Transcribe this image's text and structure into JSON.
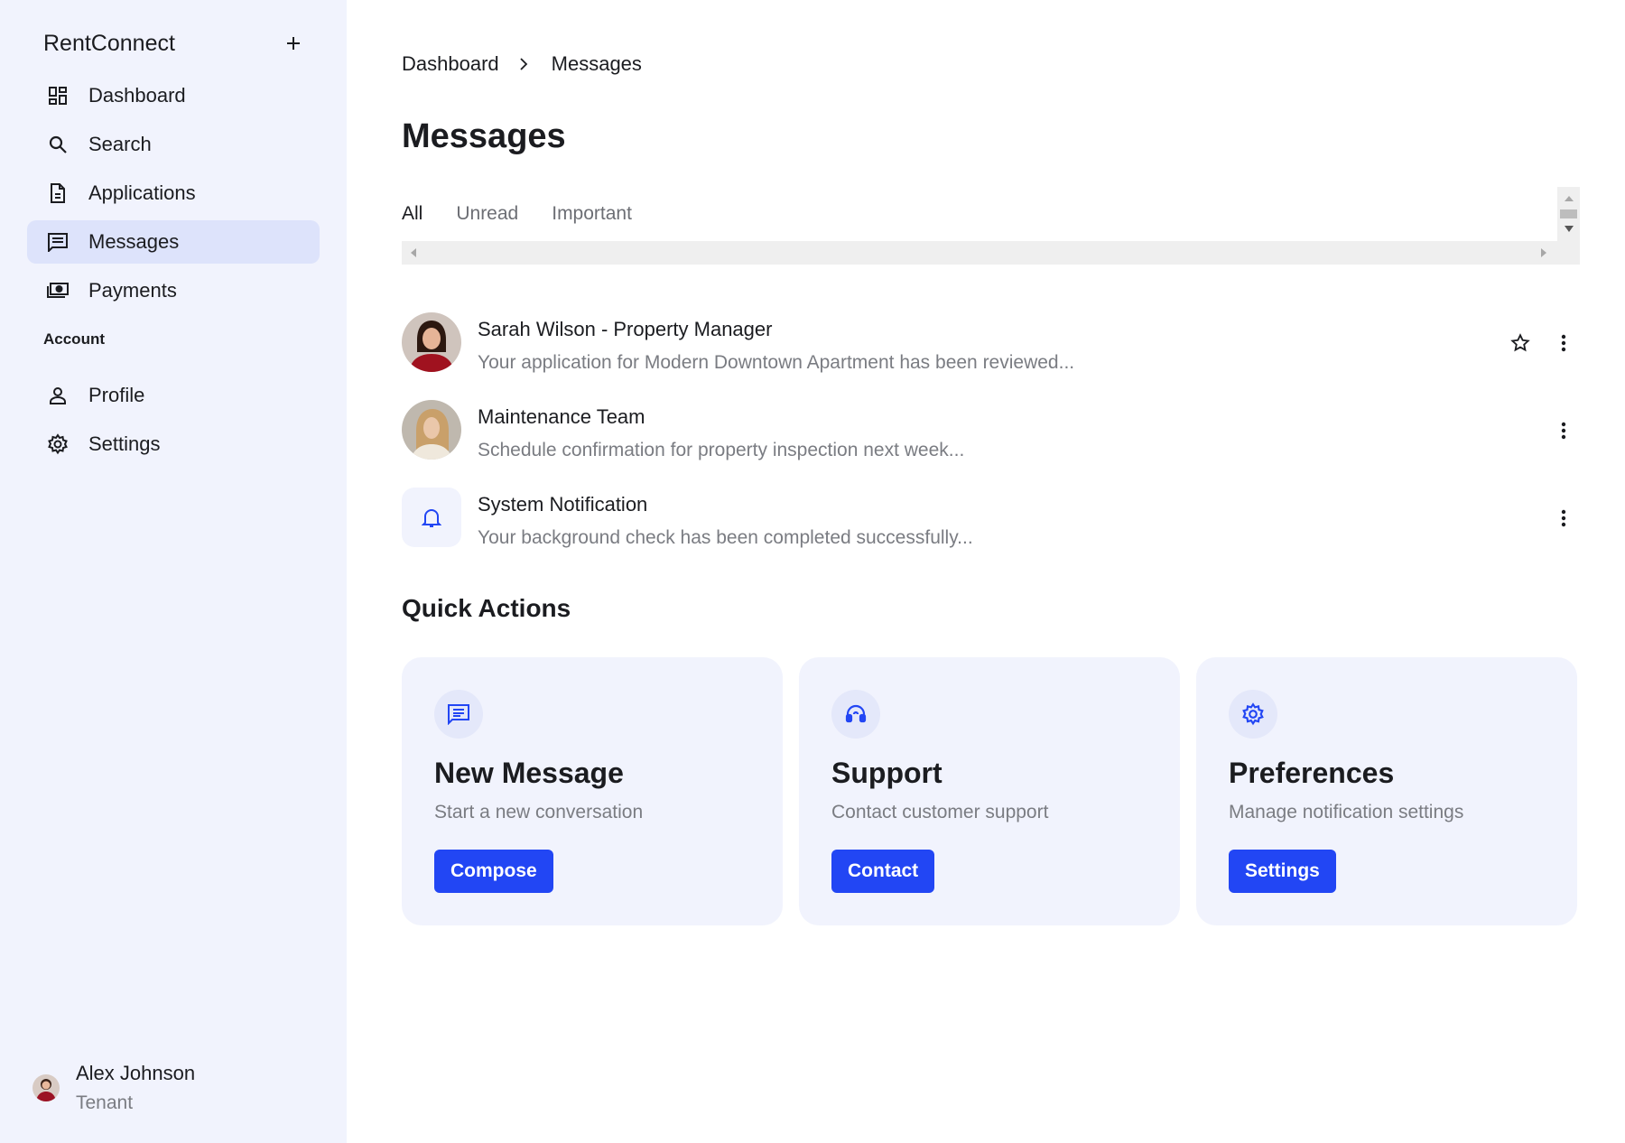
{
  "app": {
    "name": "RentConnect"
  },
  "sidebar": {
    "items": [
      {
        "label": "Dashboard",
        "icon": "dashboard-icon"
      },
      {
        "label": "Search",
        "icon": "search-icon"
      },
      {
        "label": "Applications",
        "icon": "document-icon"
      },
      {
        "label": "Messages",
        "icon": "message-icon",
        "active": true
      },
      {
        "label": "Payments",
        "icon": "payments-icon"
      }
    ],
    "section_label": "Account",
    "account_items": [
      {
        "label": "Profile",
        "icon": "person-icon"
      },
      {
        "label": "Settings",
        "icon": "gear-icon"
      }
    ]
  },
  "user": {
    "name": "Alex Johnson",
    "role": "Tenant"
  },
  "breadcrumb": {
    "items": [
      "Dashboard",
      "Messages"
    ]
  },
  "page": {
    "title": "Messages"
  },
  "tabs": [
    {
      "label": "All",
      "active": true
    },
    {
      "label": "Unread"
    },
    {
      "label": "Important"
    }
  ],
  "messages": [
    {
      "title": "Sarah Wilson - Property Manager",
      "preview": "Your application for Modern Downtown Apartment has been reviewed...",
      "avatar": "photo",
      "starred": true
    },
    {
      "title": "Maintenance Team",
      "preview": "Schedule confirmation for property inspection next week...",
      "avatar": "photo"
    },
    {
      "title": "System Notification",
      "preview": "Your background check has been completed successfully...",
      "avatar": "bell-icon"
    }
  ],
  "quick_actions": {
    "title": "Quick Actions",
    "cards": [
      {
        "title": "New Message",
        "description": "Start a new conversation",
        "button": "Compose",
        "icon": "message-icon"
      },
      {
        "title": "Support",
        "description": "Contact customer support",
        "button": "Contact",
        "icon": "headset-icon"
      },
      {
        "title": "Preferences",
        "description": "Manage notification settings",
        "button": "Settings",
        "icon": "gear-icon"
      }
    ]
  },
  "colors": {
    "accent": "#2246f4",
    "sidebar_bg": "#f1f3fd",
    "active_bg": "#dde3fb"
  }
}
